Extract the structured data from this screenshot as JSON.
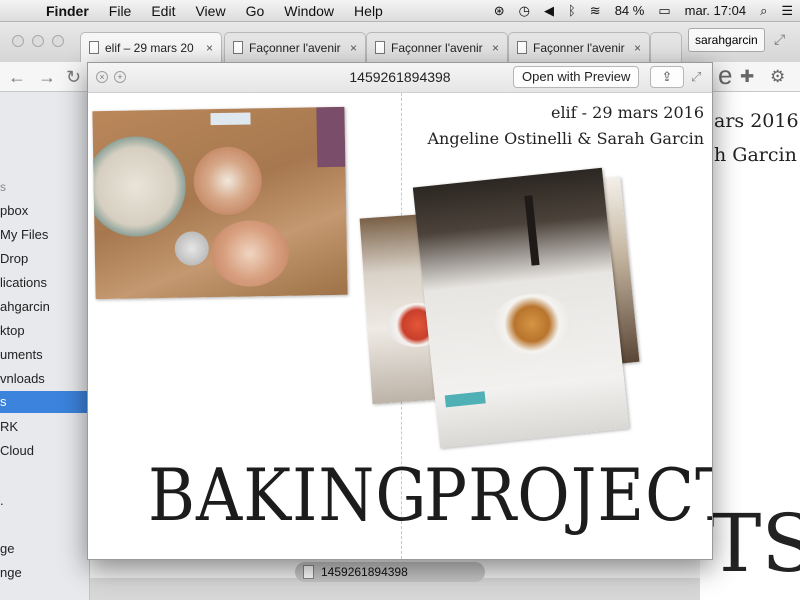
{
  "menubar": {
    "app": "Finder",
    "items": [
      "File",
      "Edit",
      "View",
      "Go",
      "Window",
      "Help"
    ],
    "battery": "84 %",
    "clock": "mar. 17:04"
  },
  "browser": {
    "tabs": [
      {
        "label": "elif – 29 mars 20"
      },
      {
        "label": "Façonner l'avenir"
      },
      {
        "label": "Façonner l'avenir"
      },
      {
        "label": "Façonner l'avenir"
      }
    ],
    "profile": "sarahgarcin"
  },
  "finder_sidebar": {
    "items": [
      {
        "label": "s",
        "type": "header"
      },
      {
        "label": "pbox"
      },
      {
        "label": "My Files"
      },
      {
        "label": "Drop"
      },
      {
        "label": "lications"
      },
      {
        "label": "ahgarcin"
      },
      {
        "label": "ktop"
      },
      {
        "label": "uments"
      },
      {
        "label": "vnloads"
      },
      {
        "label": "s",
        "selected": true
      },
      {
        "label": "RK"
      },
      {
        "label": "Cloud"
      },
      {
        "label": "."
      },
      {
        "label": "ge"
      },
      {
        "label": "nge"
      }
    ]
  },
  "background": {
    "line1": "ars 2016",
    "line2": "h Garcin",
    "big": "TS"
  },
  "bottom_file": "1459261894398",
  "quicklook": {
    "title": "1459261894398",
    "open_button": "Open with Preview",
    "document": {
      "date_line": "elif - 29 mars 2016",
      "authors_line": "Angeline Ostinelli & Sarah Garcin",
      "title_left": "BAKING",
      "title_right": "PROJECTS"
    }
  }
}
